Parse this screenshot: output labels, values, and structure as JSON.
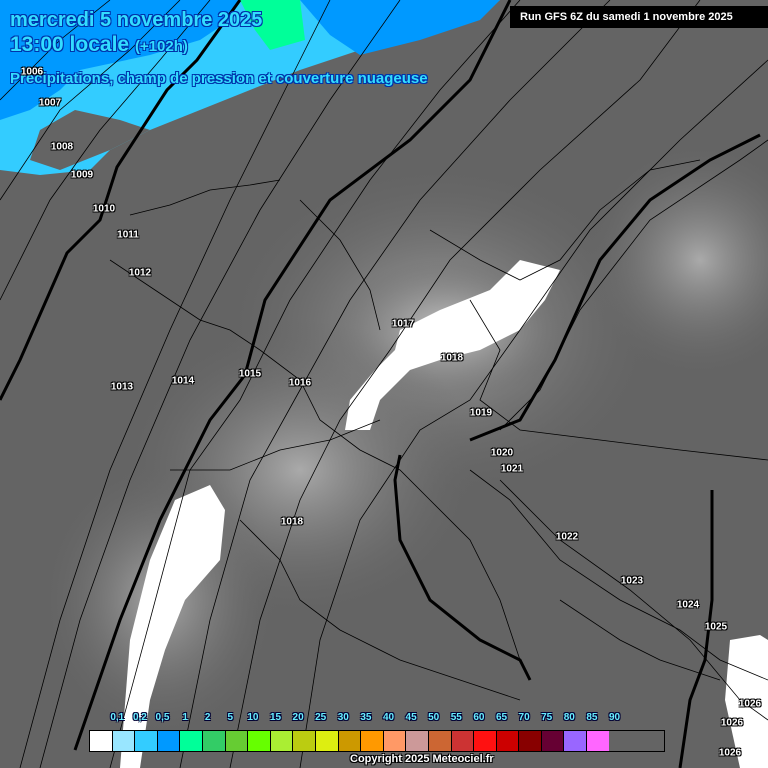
{
  "header": {
    "date": "mercredi 5 novembre 2025",
    "time": "13:00 locale",
    "lead": "(+102h)",
    "subtitle": "Précipitations, champ de pression et couverture nuageuse",
    "run": "Run GFS 6Z du samedi 1 novembre 2025"
  },
  "isobar_labels": [
    "1006",
    "1007",
    "1008",
    "1009",
    "1010",
    "1011",
    "1012",
    "1013",
    "1014",
    "1015",
    "1016",
    "1017",
    "1018",
    "1019",
    "1020",
    "1021",
    "1022",
    "1023",
    "1024",
    "1025",
    "1026",
    "1026",
    "1026",
    "1018"
  ],
  "legend": {
    "labels": [
      "0,1",
      "0,2",
      "0,5",
      "1",
      "2",
      "5",
      "10",
      "15",
      "20",
      "25",
      "30",
      "35",
      "40",
      "45",
      "50",
      "55",
      "60",
      "65",
      "70",
      "75",
      "80",
      "85",
      "90"
    ],
    "colors": [
      "#ffffff",
      "#99e6ff",
      "#33ccff",
      "#0099ff",
      "#00ff99",
      "#33cc66",
      "#66cc33",
      "#66ff00",
      "#aaee33",
      "#bbcc11",
      "#ddee11",
      "#cc9900",
      "#ff9900",
      "#ff9966",
      "#cc9999",
      "#cc6633",
      "#cc3333",
      "#ff1111",
      "#cc0000",
      "#880000",
      "#660033",
      "#9966ff",
      "#ff66ff"
    ]
  },
  "copyright": "Copyright 2025 Meteociel.fr"
}
